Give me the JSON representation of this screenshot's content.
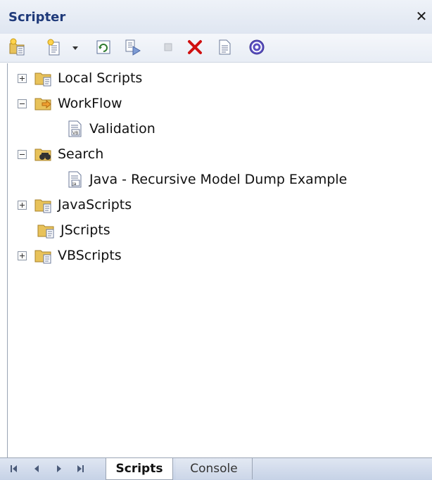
{
  "panel": {
    "title": "Scripter",
    "close_glyph": "✕"
  },
  "toolbar": {
    "buttons": [
      {
        "icon": "new-group-icon"
      },
      {
        "icon": "new-script-icon"
      },
      {
        "icon": "dropdown-arrow-icon"
      },
      {
        "icon": "refresh-icon"
      },
      {
        "icon": "run-script-icon"
      },
      {
        "icon": "stop-icon"
      },
      {
        "icon": "delete-icon"
      },
      {
        "icon": "properties-icon"
      },
      {
        "icon": "help-icon"
      }
    ],
    "colors": {
      "delete": "#d01010",
      "help": "#5a4fc0"
    }
  },
  "tree": {
    "items": [
      {
        "label": "Local Scripts",
        "expander": "plus",
        "icon": "script-folder-icon"
      },
      {
        "label": "WorkFlow",
        "expander": "minus",
        "icon": "workflow-folder-icon"
      },
      {
        "label": "Validation",
        "expander": "none",
        "icon": "vb-script-icon"
      },
      {
        "label": "Search",
        "expander": "minus",
        "icon": "search-folder-icon"
      },
      {
        "label": "Java - Recursive Model Dump Example",
        "expander": "none",
        "icon": "js-script-icon"
      },
      {
        "label": "JavaScripts",
        "expander": "plus",
        "icon": "script-folder-icon"
      },
      {
        "label": "JScripts",
        "expander": "none",
        "icon": "script-folder-icon"
      },
      {
        "label": "VBScripts",
        "expander": "plus",
        "icon": "script-folder-icon"
      }
    ]
  },
  "footer": {
    "tabs": [
      {
        "label": "Scripts",
        "active": true
      },
      {
        "label": "Console",
        "active": false
      }
    ],
    "nav_icons": [
      "first-icon",
      "prev-icon",
      "next-icon",
      "last-icon"
    ]
  }
}
